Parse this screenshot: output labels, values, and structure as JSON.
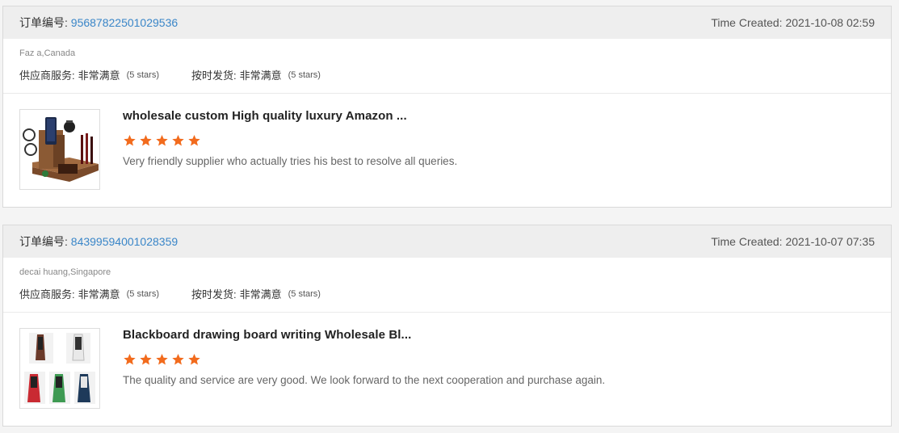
{
  "reviews": [
    {
      "order_label": "订单编号:",
      "order_number": "95687822501029536",
      "time_label": "Time Created:",
      "time_value": "2021-10-08 02:59",
      "buyer": "Faz a,Canada",
      "supplier_service_label": "供应商服务:",
      "supplier_service_value": "非常满意",
      "supplier_service_stars": "(5 stars)",
      "shipping_label": "按时发货:",
      "shipping_value": "非常满意",
      "shipping_stars": "(5 stars)",
      "product_title": "wholesale custom High quality luxury Amazon ...",
      "rating": 5,
      "comment": "Very friendly supplier who actually tries his best to resolve all queries.",
      "thumb_icon": "wooden-phone-dock-image"
    },
    {
      "order_label": "订单编号:",
      "order_number": "84399594001028359",
      "time_label": "Time Created:",
      "time_value": "2021-10-07 07:35",
      "buyer": "decai huang,Singapore",
      "supplier_service_label": "供应商服务:",
      "supplier_service_value": "非常满意",
      "supplier_service_stars": "(5 stars)",
      "shipping_label": "按时发货:",
      "shipping_value": "非常满意",
      "shipping_stars": "(5 stars)",
      "product_title": "Blackboard drawing board writing Wholesale Bl...",
      "rating": 5,
      "comment": "The quality and service are very good. We look forward to the next cooperation and purchase again.",
      "thumb_icon": "easel-blackboard-image"
    }
  ],
  "colors": {
    "link": "#3a86c8",
    "star": "#f26b1d",
    "header_bg": "#eeeeee"
  }
}
